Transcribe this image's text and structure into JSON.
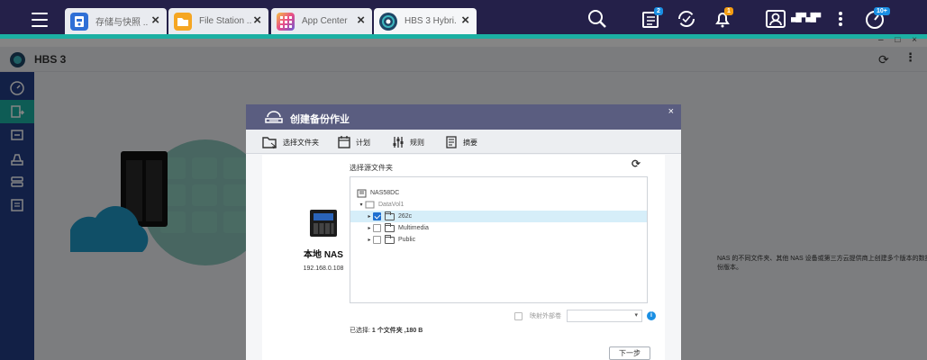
{
  "taskbar": {
    "tabs": [
      {
        "label": "存储与快照 ...",
        "icon": "storage-snapshot-icon",
        "color": "#2f6fd6"
      },
      {
        "label": "File Station ...",
        "icon": "file-station-icon",
        "color": "#f5a623"
      },
      {
        "label": "App Center",
        "icon": "app-center-icon",
        "color": "#e84c88"
      },
      {
        "label": "HBS 3 Hybri...",
        "icon": "hbs3-icon",
        "color": "#1e4666"
      }
    ],
    "notification_badges": {
      "tasks": "2",
      "alerts": "1",
      "system": "10+"
    },
    "username": "▄█▀▄█▀"
  },
  "window": {
    "controls": "– □ ×",
    "app_title": "HBS 3",
    "more_label": "⋮"
  },
  "background_text": "NAS 的不同文件夹、其他 NAS 设备或第三方云提供商上创建多个版本的数据备份版本。",
  "dialog": {
    "title": "创建备份作业",
    "close_label": "×",
    "steps": [
      {
        "label": "选择文件夹",
        "icon": "folder-select-icon"
      },
      {
        "label": "计划",
        "icon": "calendar-icon"
      },
      {
        "label": "规则",
        "icon": "sliders-icon"
      },
      {
        "label": "摘要",
        "icon": "summary-icon"
      }
    ],
    "nas": {
      "name": "本地 NAS",
      "ip": "192.168.0.108"
    },
    "source_title": "选择源文件夹",
    "tree": {
      "root": "NAS58DC",
      "volume": "DataVol1",
      "folders": [
        {
          "name": "262c",
          "checked": true,
          "selected": true
        },
        {
          "name": "Multimedia",
          "checked": false,
          "selected": false
        },
        {
          "name": "Public",
          "checked": false,
          "selected": false
        }
      ]
    },
    "map_external_label": "映射外部卷",
    "map_external_checked": false,
    "select_value": "",
    "selected_summary_prefix": "已选择:",
    "selected_summary_value": "1 个文件夹 ,180 B",
    "next_label": "下一步"
  },
  "colors": {
    "topbar": "#242049",
    "accent_teal": "#1bb0a3",
    "sidebar": "#233f86",
    "dialog_header": "#5a5d80",
    "checkbox_blue": "#1e6fd0",
    "badge_blue": "#1a8fe3",
    "badge_orange": "#f39c12"
  }
}
